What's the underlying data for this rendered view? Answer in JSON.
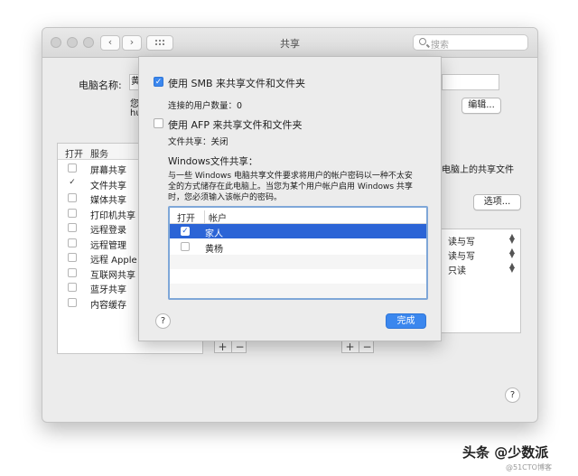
{
  "window": {
    "title": "共享",
    "search_placeholder": "搜索"
  },
  "background": {
    "computer_name_label": "电脑名称:",
    "computer_name_value": "黄",
    "partial_text_1": "您",
    "partial_text_2": "hu",
    "edit_button": "编辑...",
    "right_text": "电脑上的共享文件",
    "options_button": "选项..."
  },
  "services": {
    "header_on": "打开",
    "header_service": "服务",
    "items": [
      {
        "label": "屏幕共享",
        "checked": false
      },
      {
        "label": "文件共享",
        "checked": true
      },
      {
        "label": "媒体共享",
        "checked": false
      },
      {
        "label": "打印机共享",
        "checked": false
      },
      {
        "label": "远程登录",
        "checked": false
      },
      {
        "label": "远程管理",
        "checked": false
      },
      {
        "label": "远程 Apple",
        "checked": false
      },
      {
        "label": "互联网共享",
        "checked": false
      },
      {
        "label": "蓝牙共享",
        "checked": false
      },
      {
        "label": "内容缓存",
        "checked": false
      }
    ],
    "check_glyph": "✓"
  },
  "permissions": [
    "读与写",
    "读与写",
    "只读"
  ],
  "plus": "+",
  "minus": "−",
  "help": "?",
  "sheet": {
    "smb_label": "使用 SMB 来共享文件和文件夹",
    "smb_checked": true,
    "connected_users": "连接的用户数量：0",
    "afp_label": "使用 AFP 来共享文件和文件夹",
    "afp_checked": false,
    "file_sharing_status": "文件共享：关闭",
    "windows_title": "Windows文件共享：",
    "windows_desc_1": "与一些 Windows 电脑共享文件要求将用户的帐户密码以一种不太安",
    "windows_desc_2": "全的方式储存在此电脑上。当您为某个用户帐户启用 Windows 共享",
    "windows_desc_3": "时，您必须输入该帐户的密码。",
    "list_header_on": "打开",
    "list_header_account": "帐户",
    "accounts": [
      {
        "name": "家人",
        "checked": true,
        "selected": true
      },
      {
        "name": "黄杨",
        "checked": false,
        "selected": false
      }
    ],
    "done_button": "完成",
    "check_glyph": "✓"
  },
  "watermark": "头条 @少数派",
  "watermark_small": "@51CTO博客",
  "colors": {
    "accent": "#3b87ee",
    "selection": "#2b64d6"
  }
}
